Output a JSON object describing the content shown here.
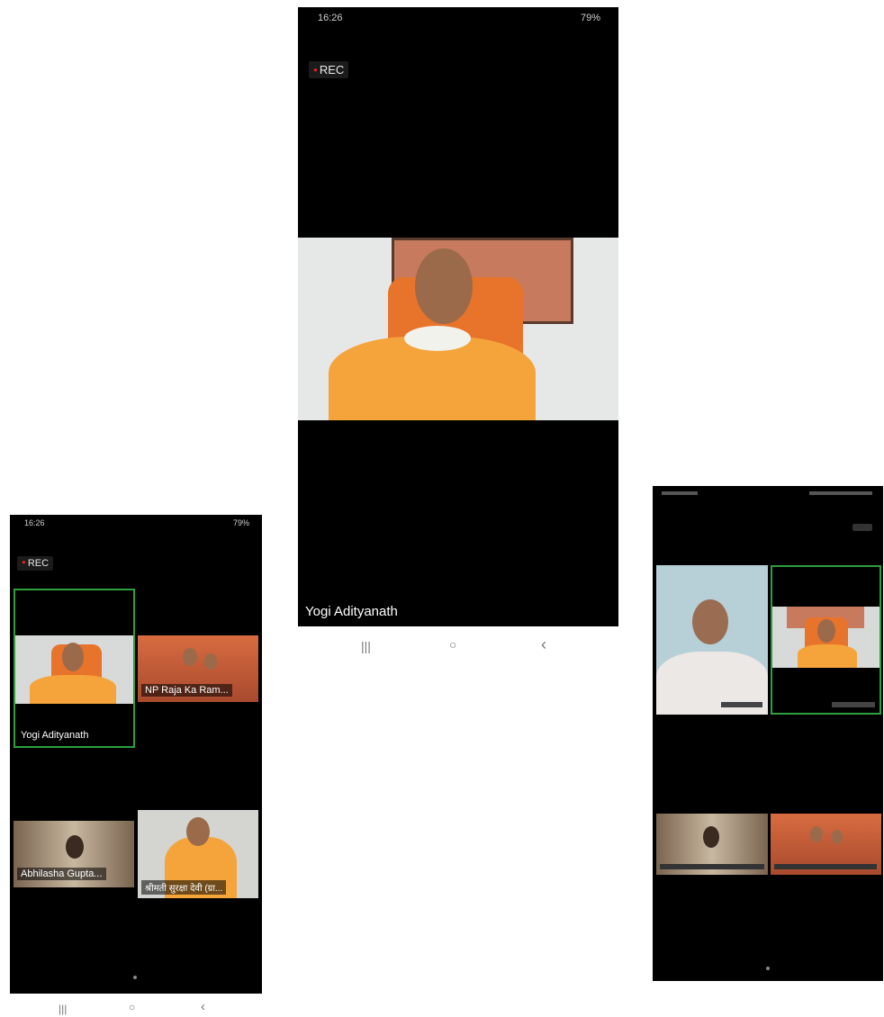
{
  "phone_center": {
    "status_time": "16:26",
    "status_right": "79%",
    "rec_label": "REC",
    "speaker_name": "Yogi Adityanath"
  },
  "phone_left": {
    "status_time": "16:26",
    "status_right": "79%",
    "rec_label": "REC",
    "tiles": [
      {
        "name": "Yogi Adityanath"
      },
      {
        "name": "NP Raja Ka Ram..."
      },
      {
        "name": "Abhilasha Gupta..."
      },
      {
        "name": "श्रीमती सुरक्षा देवी (ग्रा..."
      }
    ]
  },
  "phone_right": {
    "tiles": [
      {
        "name": ""
      },
      {
        "name": ""
      },
      {
        "name": ""
      },
      {
        "name": ""
      }
    ]
  },
  "navbar": {
    "recents": "|||",
    "home": "○",
    "back": "‹"
  },
  "colors": {
    "active_border": "#2e9e3e",
    "robe": "#f5a43b",
    "chair": "#e8732a"
  }
}
